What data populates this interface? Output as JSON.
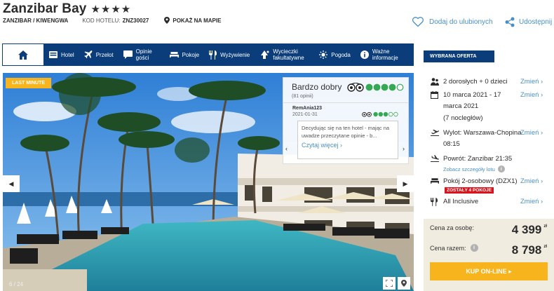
{
  "header": {
    "hotel_name": "Zanzibar Bay",
    "stars": "★★★★",
    "location": "ZANZIBAR / KIWENGWA",
    "code_label": "KOD HOTELU:",
    "code": "ZNZ30027",
    "map_label": "POKAŻ NA MAPIE",
    "favorite_label": "Dodaj do ulubionych",
    "share_label": "Udostępnij"
  },
  "nav": {
    "items": [
      {
        "label": "Hotel",
        "icon": "bed-icon"
      },
      {
        "label": "Przelot",
        "icon": "plane-icon"
      },
      {
        "label": "Opinie gości",
        "icon": "speech-icon"
      },
      {
        "label": "Pokoje",
        "icon": "room-icon"
      },
      {
        "label": "Wyżywienie",
        "icon": "cutlery-icon"
      },
      {
        "label": "Wycieczki fakultatywne",
        "icon": "trip-icon"
      },
      {
        "label": "Pogoda",
        "icon": "sun-icon"
      },
      {
        "label": "Ważne informacje",
        "icon": "info-icon"
      }
    ]
  },
  "gallery": {
    "badge": "LAST MINUTE",
    "counter": "6 / 24",
    "prev": "◀",
    "next": "▶"
  },
  "review": {
    "rating_text": "Bardzo dobry",
    "count": "(81 opinii)",
    "user": "RemAnia123",
    "date": "2021-01-31",
    "snippet": "Decydując się na ten hotel - mając na uwadze przeczytane opinie - b...",
    "more": "Czytaj więcej",
    "overall_score": 4,
    "user_score": 3
  },
  "offer": {
    "title": "WYBRANA OFERTA",
    "change_label": "Zmień",
    "people": "2 dorosłych + 0 dzieci",
    "dates": "10 marca 2021 - 17 marca 2021",
    "nights": "(7 nocległów)",
    "departure": "Wylot: Warszawa-Chopina 08:15",
    "return": "Powrót: Zanzibar 21:35",
    "flight_details": "Zobacz szczegóły lotu",
    "room": "Pokój 2-osobowy (DZX1)",
    "rooms_left": "ZOSTAŁY 4 POKOJE",
    "board": "All Inclusive"
  },
  "price": {
    "per_person_label": "Cena za osobę:",
    "per_person": "4 399",
    "total_label": "Cena razem:",
    "total": "8 798",
    "currency": "zł",
    "buy_label": "KUP ON-LINE ▸"
  },
  "colors": {
    "navy": "#0b3d7a",
    "accent": "#f7b41c",
    "link": "#4a90c8",
    "tripadvisor": "#34a853",
    "alert": "#d9141d"
  }
}
